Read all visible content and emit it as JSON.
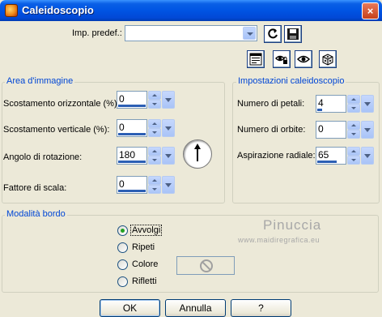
{
  "window": {
    "title": "Caleidoscopio",
    "close": "×"
  },
  "preset": {
    "label": "Imp. predef.:",
    "value": ""
  },
  "image_area": {
    "title": "Area d'immagine",
    "fields": [
      {
        "label": "Scostamento orizzontale (%):",
        "value": "0"
      },
      {
        "label": "Scostamento verticale (%):",
        "value": "0"
      },
      {
        "label": "Angolo di rotazione:",
        "value": "180"
      },
      {
        "label": "Fattore di scala:",
        "value": "0"
      }
    ]
  },
  "kaleido_settings": {
    "title": "Impostazioni caleidoscopio",
    "fields": [
      {
        "label": "Numero di petali:",
        "value": "4"
      },
      {
        "label": "Numero di orbite:",
        "value": "0"
      },
      {
        "label": "Aspirazione radiale:",
        "value": "65"
      }
    ]
  },
  "edge_mode": {
    "title": "Modalità bordo",
    "options": [
      {
        "label": "Avvolgi",
        "checked": true
      },
      {
        "label": "Ripeti",
        "checked": false
      },
      {
        "label": "Colore",
        "checked": false
      },
      {
        "label": "Rifletti",
        "checked": false
      }
    ]
  },
  "watermark": {
    "name": "Pinuccia",
    "site": "www.maidiregrafica.eu"
  },
  "buttons": {
    "ok": "OK",
    "cancel": "Annulla",
    "help": "?"
  },
  "colors": {
    "title_bar": "#0054e3",
    "group_title": "#0046d5",
    "background": "#ece9d8"
  }
}
